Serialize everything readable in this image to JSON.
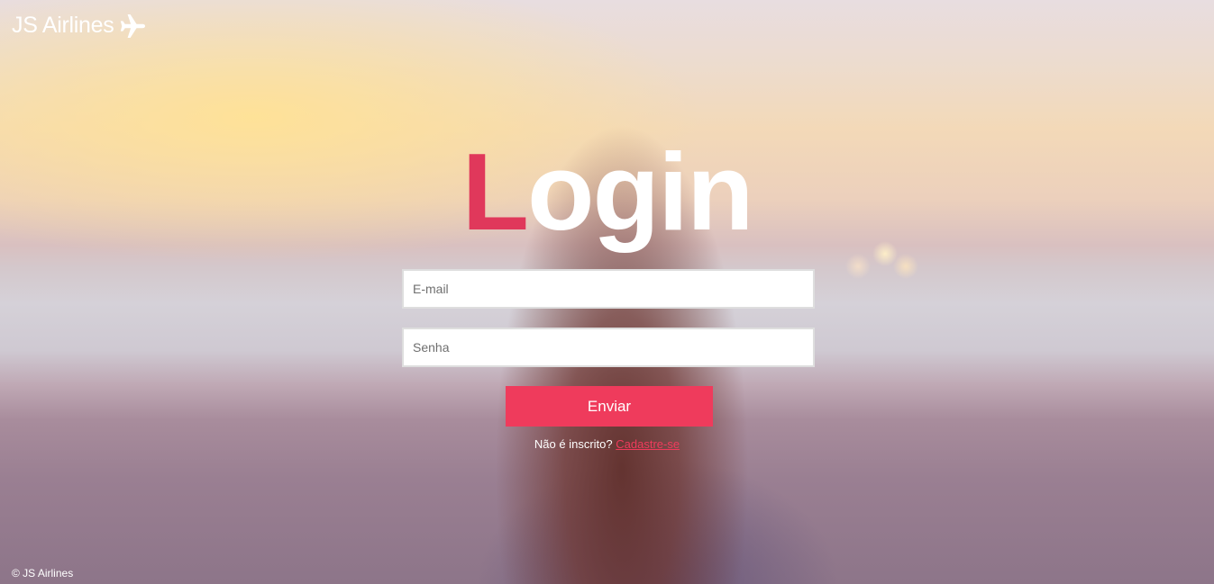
{
  "header": {
    "brand": "JS Airlines",
    "brand_icon": "airplane-icon"
  },
  "login": {
    "title_first_letter": "L",
    "title_rest": "ogin",
    "email_placeholder": "E-mail",
    "password_placeholder": "Senha",
    "submit_label": "Enviar",
    "signup_prompt": "Não é inscrito?",
    "signup_link": "Cadastre-se"
  },
  "footer": {
    "copyright": "© JS Airlines"
  },
  "colors": {
    "accent": "#ef3b5c",
    "title_accent": "#e0385b",
    "text_light": "#ffffff"
  }
}
